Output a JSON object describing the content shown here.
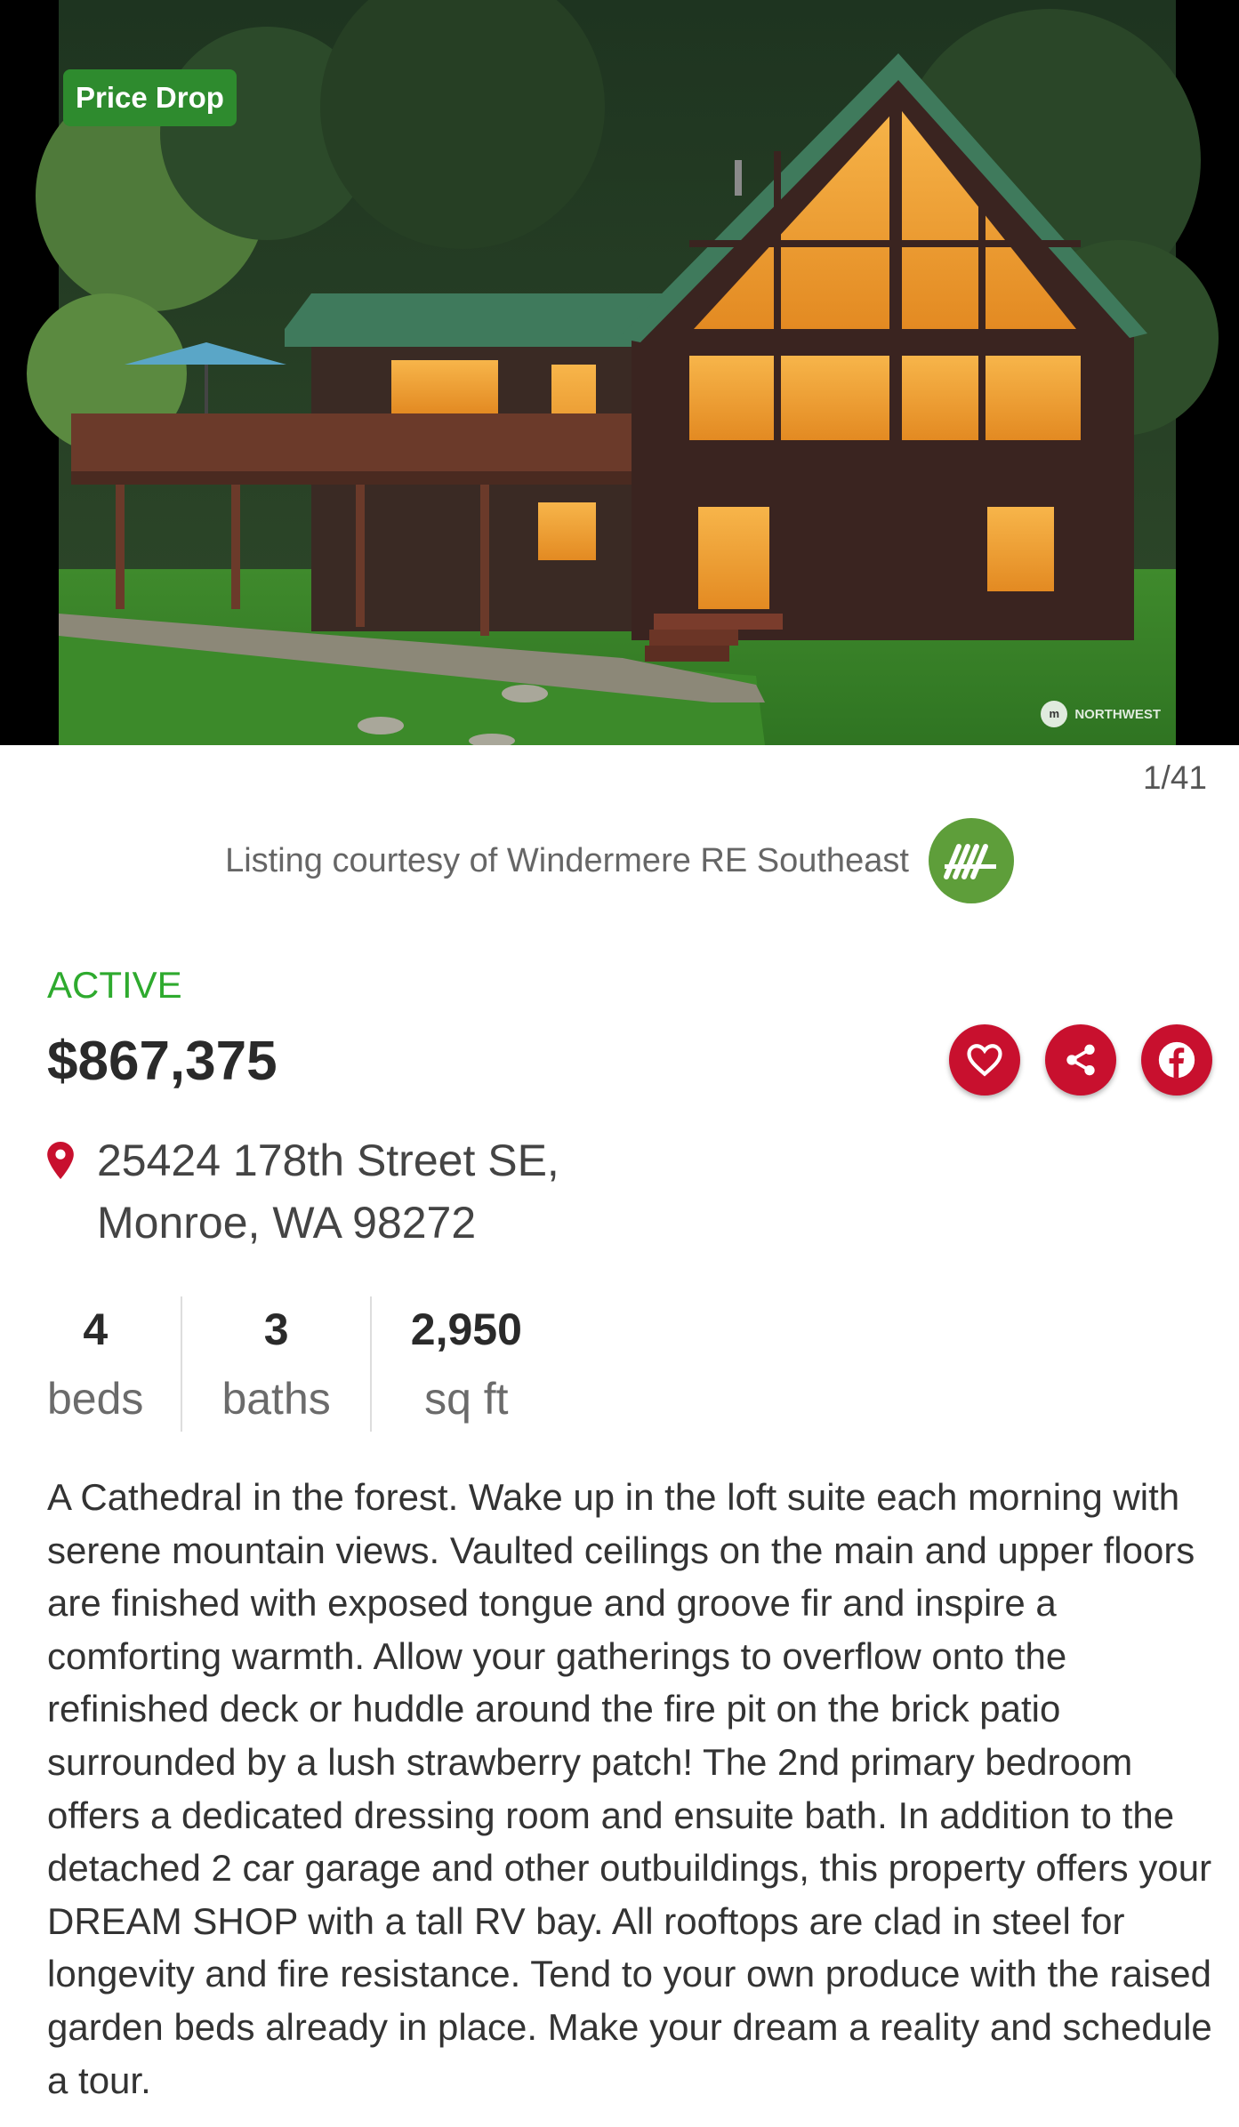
{
  "photo": {
    "badge": "Price Drop",
    "watermark": "NORTHWEST",
    "counter": "1/41"
  },
  "listing": {
    "courtesy": "Listing courtesy of Windermere RE Southeast",
    "status": "ACTIVE",
    "price": "$867,375",
    "address_line1": "25424 178th Street SE,",
    "address_line2": "Monroe, WA 98272"
  },
  "stats": {
    "beds_value": "4",
    "beds_label": "beds",
    "baths_value": "3",
    "baths_label": "baths",
    "sqft_value": "2,950",
    "sqft_label": "sq ft"
  },
  "description": "A Cathedral in the forest. Wake up in the loft suite each morning with serene mountain views. Vaulted ceilings on the main and upper floors are finished with exposed tongue and groove fir and inspire a comforting warmth. Allow your gatherings to overflow onto the refinished deck or huddle around the fire pit on the brick patio surrounded by a lush strawberry patch! The 2nd primary bedroom offers a dedicated dressing room and ensuite bath. In addition to the detached 2 car garage and other outbuildings, this property offers your DREAM SHOP with a tall RV bay. All rooftops are clad in steel for longevity and fire resistance. Tend to your own produce with the raised garden beds already in place. Make your dream a reality and schedule a tour.",
  "icons": {
    "favorite": "heart-icon",
    "share": "share-icon",
    "facebook": "facebook-icon",
    "location": "map-pin-icon",
    "broker": "windermere-logo"
  },
  "colors": {
    "badge": "#2e8b2e",
    "status": "#2eaa2e",
    "action_buttons": "#c8102e",
    "broker_logo": "#5e9e3a"
  }
}
